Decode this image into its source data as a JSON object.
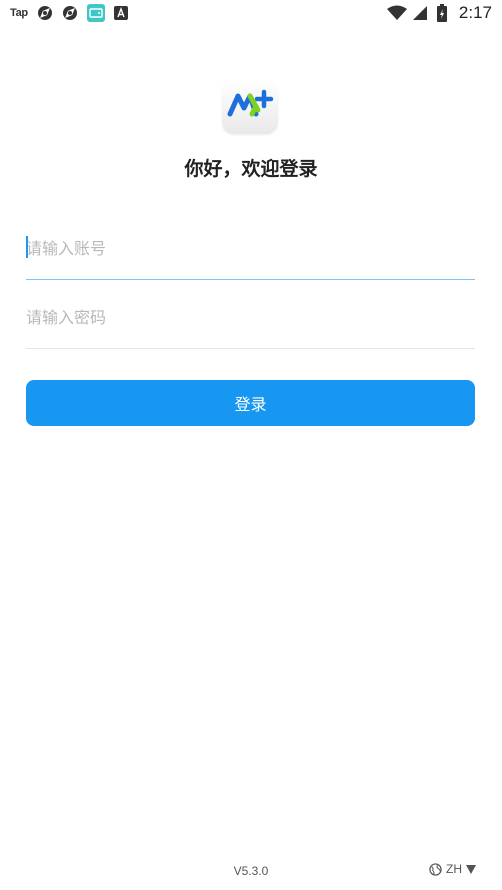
{
  "status_bar": {
    "app_label": "Tap",
    "time": "2:17",
    "icons": [
      "tap-app-icon",
      "aperture-icon",
      "aperture-icon",
      "wallet-notification-icon",
      "a-notification-icon",
      "wifi-icon",
      "cell-signal-icon",
      "battery-icon"
    ]
  },
  "login": {
    "title": "你好，欢迎登录",
    "account_placeholder": "请输入账号",
    "password_placeholder": "请输入密码",
    "submit_label": "登录"
  },
  "footer": {
    "version": "V5.3.0",
    "language": "ZH"
  },
  "colors": {
    "accent": "#1797f2",
    "logo_blue": "#1e6fd9",
    "logo_green": "#7ed321"
  }
}
